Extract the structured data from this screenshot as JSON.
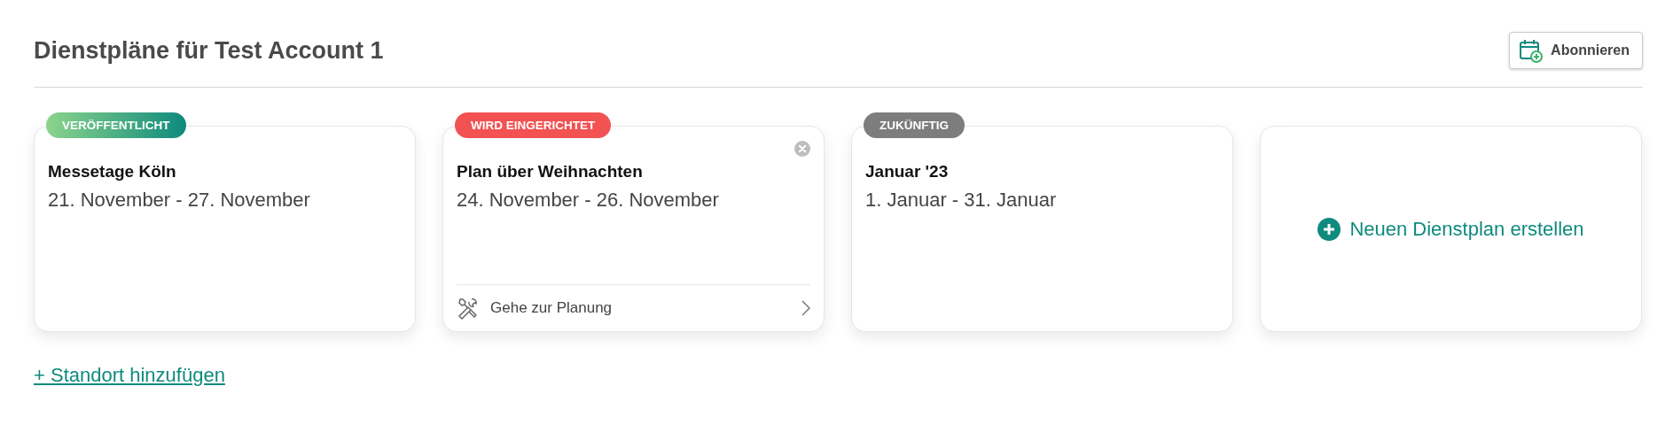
{
  "header": {
    "title": "Dienstpläne für Test Account 1",
    "subscribe_button": "Abonnieren"
  },
  "plans": [
    {
      "status": {
        "kind": "published",
        "label": "VERÖFFENTLICHT"
      },
      "name": "Messetage Köln",
      "dates": "21. November - 27. November",
      "closable": false
    },
    {
      "status": {
        "kind": "setup",
        "label": "WIRD EINGERICHTET"
      },
      "name": "Plan über Weihnachten",
      "dates": "24. November - 26. November",
      "closable": true,
      "action": "Gehe zur Planung"
    },
    {
      "status": {
        "kind": "future",
        "label": "ZUKÜNFTIG"
      },
      "name": "Januar '23",
      "dates": "1. Januar - 31. Januar",
      "closable": false
    }
  ],
  "new_plan": "Neuen Dienstplan erstellen",
  "add_location_link": "+ Standort hinzufügen"
}
